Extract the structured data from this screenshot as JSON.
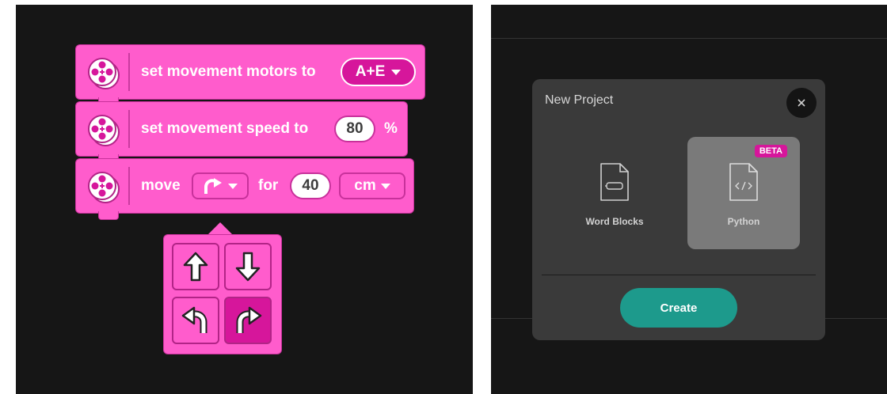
{
  "left_panel": {
    "blocks": [
      {
        "text": "set movement motors to",
        "dropdown_value": "A+E",
        "icon": "motor-icon"
      },
      {
        "text": "set movement speed to",
        "input_value": "80",
        "unit": "%",
        "icon": "motor-icon"
      },
      {
        "text_before": "move",
        "direction_icon": "turn-clockwise-arrow-icon",
        "text_mid": "for",
        "input_value": "40",
        "unit_dropdown": "cm",
        "icon": "motor-icon"
      }
    ],
    "direction_popup": {
      "options": [
        {
          "icon": "arrow-up-icon",
          "selected": false
        },
        {
          "icon": "arrow-down-icon",
          "selected": false
        },
        {
          "icon": "turn-counterclockwise-arrow-icon",
          "selected": false
        },
        {
          "icon": "turn-clockwise-arrow-icon",
          "selected": true
        }
      ]
    },
    "colors": {
      "block": "#ff5ccc",
      "accent": "#d6169b",
      "background": "#161616"
    }
  },
  "right_panel": {
    "modal": {
      "title": "New Project",
      "options": [
        {
          "label": "Word Blocks",
          "icon": "blocks-file-icon",
          "selected": false
        },
        {
          "label": "Python",
          "icon": "code-file-icon",
          "selected": true,
          "badge": "BETA"
        }
      ],
      "create_label": "Create"
    },
    "colors": {
      "modal": "#3a3a3a",
      "create": "#1d9a8c",
      "beta": "#d6169b"
    }
  }
}
